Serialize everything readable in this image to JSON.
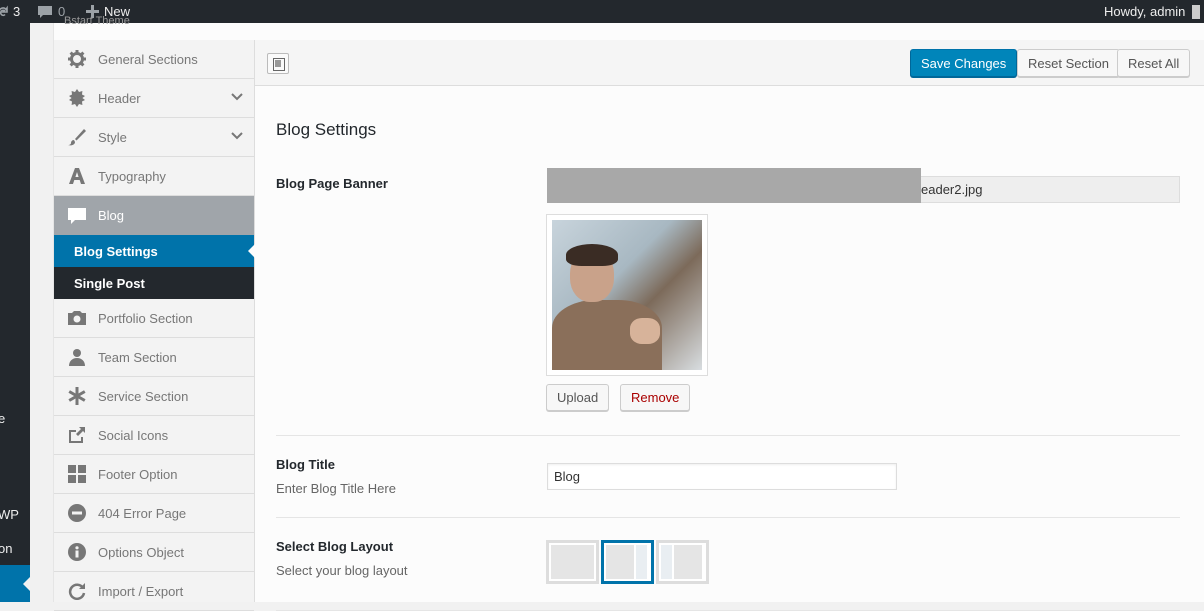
{
  "admin_bar": {
    "updates_count": "3",
    "comments_count": "0",
    "new_label": "New",
    "howdy": "Howdy, admin"
  },
  "wp_menu": {
    "fragments": [
      "e",
      "WP",
      "on"
    ]
  },
  "panel": {
    "theme_label": "Bstart Theme"
  },
  "sidebar": {
    "items": [
      {
        "label": "General Sections",
        "icon": "gear-icon"
      },
      {
        "label": "Header",
        "icon": "cog-icon",
        "chevron": true
      },
      {
        "label": "Style",
        "icon": "brush-icon",
        "chevron": true
      },
      {
        "label": "Typography",
        "icon": "font-icon"
      },
      {
        "label": "Blog",
        "icon": "comment-icon",
        "current": true
      },
      {
        "label": "Portfolio Section",
        "icon": "camera-icon"
      },
      {
        "label": "Team Section",
        "icon": "user-icon"
      },
      {
        "label": "Service Section",
        "icon": "asterisk-icon"
      },
      {
        "label": "Social Icons",
        "icon": "share-icon"
      },
      {
        "label": "Footer Option",
        "icon": "grid-icon"
      },
      {
        "label": "404 Error Page",
        "icon": "minus-circle-icon"
      },
      {
        "label": "Options Object",
        "icon": "info-icon"
      },
      {
        "label": "Import / Export",
        "icon": "refresh-icon"
      }
    ],
    "blog_sub": [
      {
        "label": "Blog Settings",
        "active": true
      },
      {
        "label": "Single Post",
        "active": false
      }
    ]
  },
  "toolbar": {
    "save_label": "Save Changes",
    "reset_section_label": "Reset Section",
    "reset_all_label": "Reset All"
  },
  "main": {
    "section_title": "Blog Settings",
    "banner": {
      "label": "Blog Page Banner",
      "value_visible": "eader2.jpg",
      "upload_label": "Upload",
      "remove_label": "Remove"
    },
    "blog_title": {
      "label": "Blog Title",
      "description": "Enter Blog Title Here",
      "value": "Blog"
    },
    "layout": {
      "label": "Select Blog Layout",
      "description": "Select your blog layout",
      "selected_index": 1
    }
  },
  "colors": {
    "accent": "#0073aa",
    "primary_button": "#0085ba",
    "admin_bar": "#23282d",
    "remove_text": "#aa0000"
  }
}
